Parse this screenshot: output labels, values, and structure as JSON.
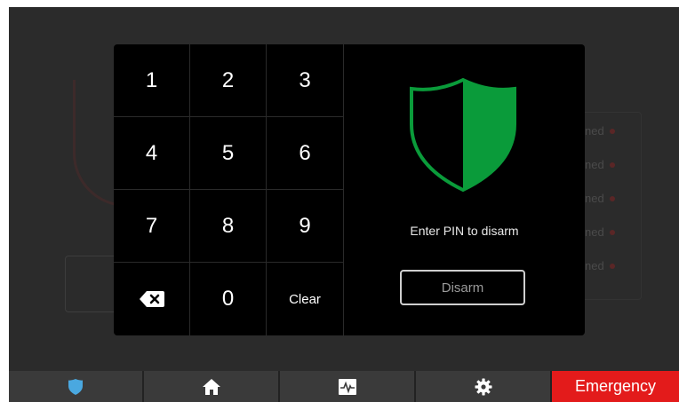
{
  "background": {
    "status_rows": [
      "ned",
      "ned",
      "ned",
      "ned",
      "ned"
    ]
  },
  "keypad": {
    "keys": [
      "1",
      "2",
      "3",
      "4",
      "5",
      "6",
      "7",
      "8",
      "9"
    ],
    "backspace_icon": "backspace-icon",
    "zero": "0",
    "clear": "Clear"
  },
  "panel": {
    "shield_colors": {
      "outline": "#0a9b3a",
      "fill": "#0a9b3a"
    },
    "prompt": "Enter PIN to disarm",
    "disarm_label": "Disarm"
  },
  "nav": {
    "items": [
      {
        "icon": "shield-icon",
        "color": "#4aa8e0"
      },
      {
        "icon": "home-icon"
      },
      {
        "icon": "activity-monitor-icon"
      },
      {
        "icon": "gear-icon"
      }
    ],
    "emergency_label": "Emergency",
    "emergency_color": "#e31b1b"
  }
}
